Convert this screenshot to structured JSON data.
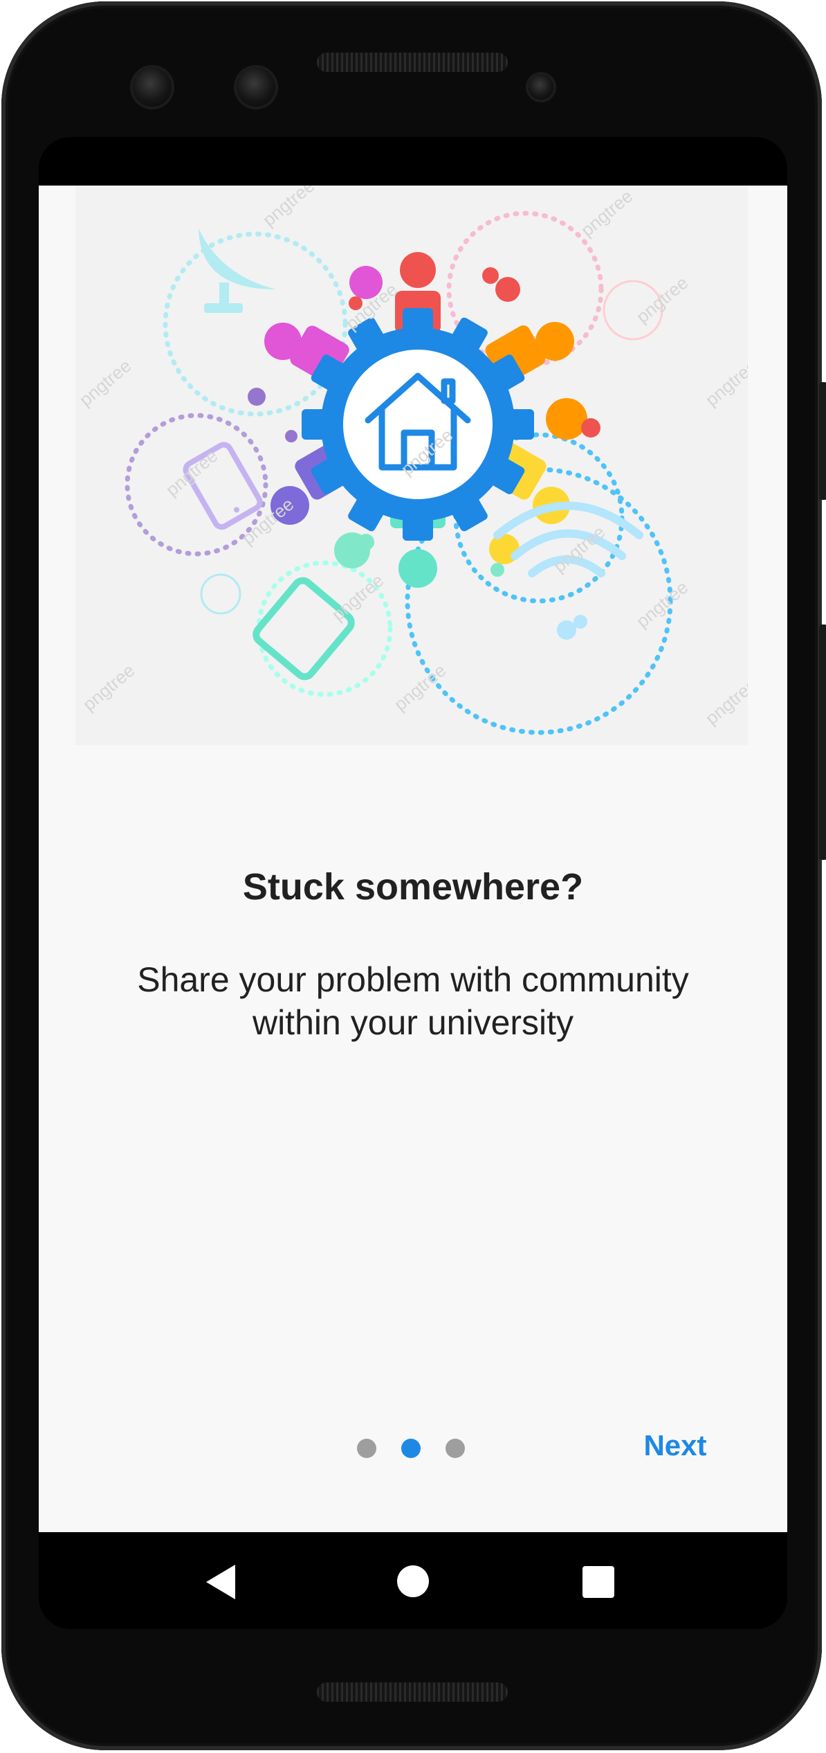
{
  "onboarding": {
    "title": "Stuck somewhere?",
    "subtitle": "Share your problem with community within your university",
    "next_label": "Next",
    "page_indicator": {
      "total": 3,
      "current": 2
    }
  },
  "illustration": {
    "icon": "community-gear-house-illustration",
    "watermark": "pngtree"
  },
  "navigation": {
    "back_icon": "triangle-back-icon",
    "home_icon": "circle-home-icon",
    "recents_icon": "square-recents-icon"
  },
  "colors": {
    "accent": "#1e88e5",
    "text": "#212121",
    "dot_inactive": "#9e9e9e",
    "background": "#f8f8f8"
  }
}
